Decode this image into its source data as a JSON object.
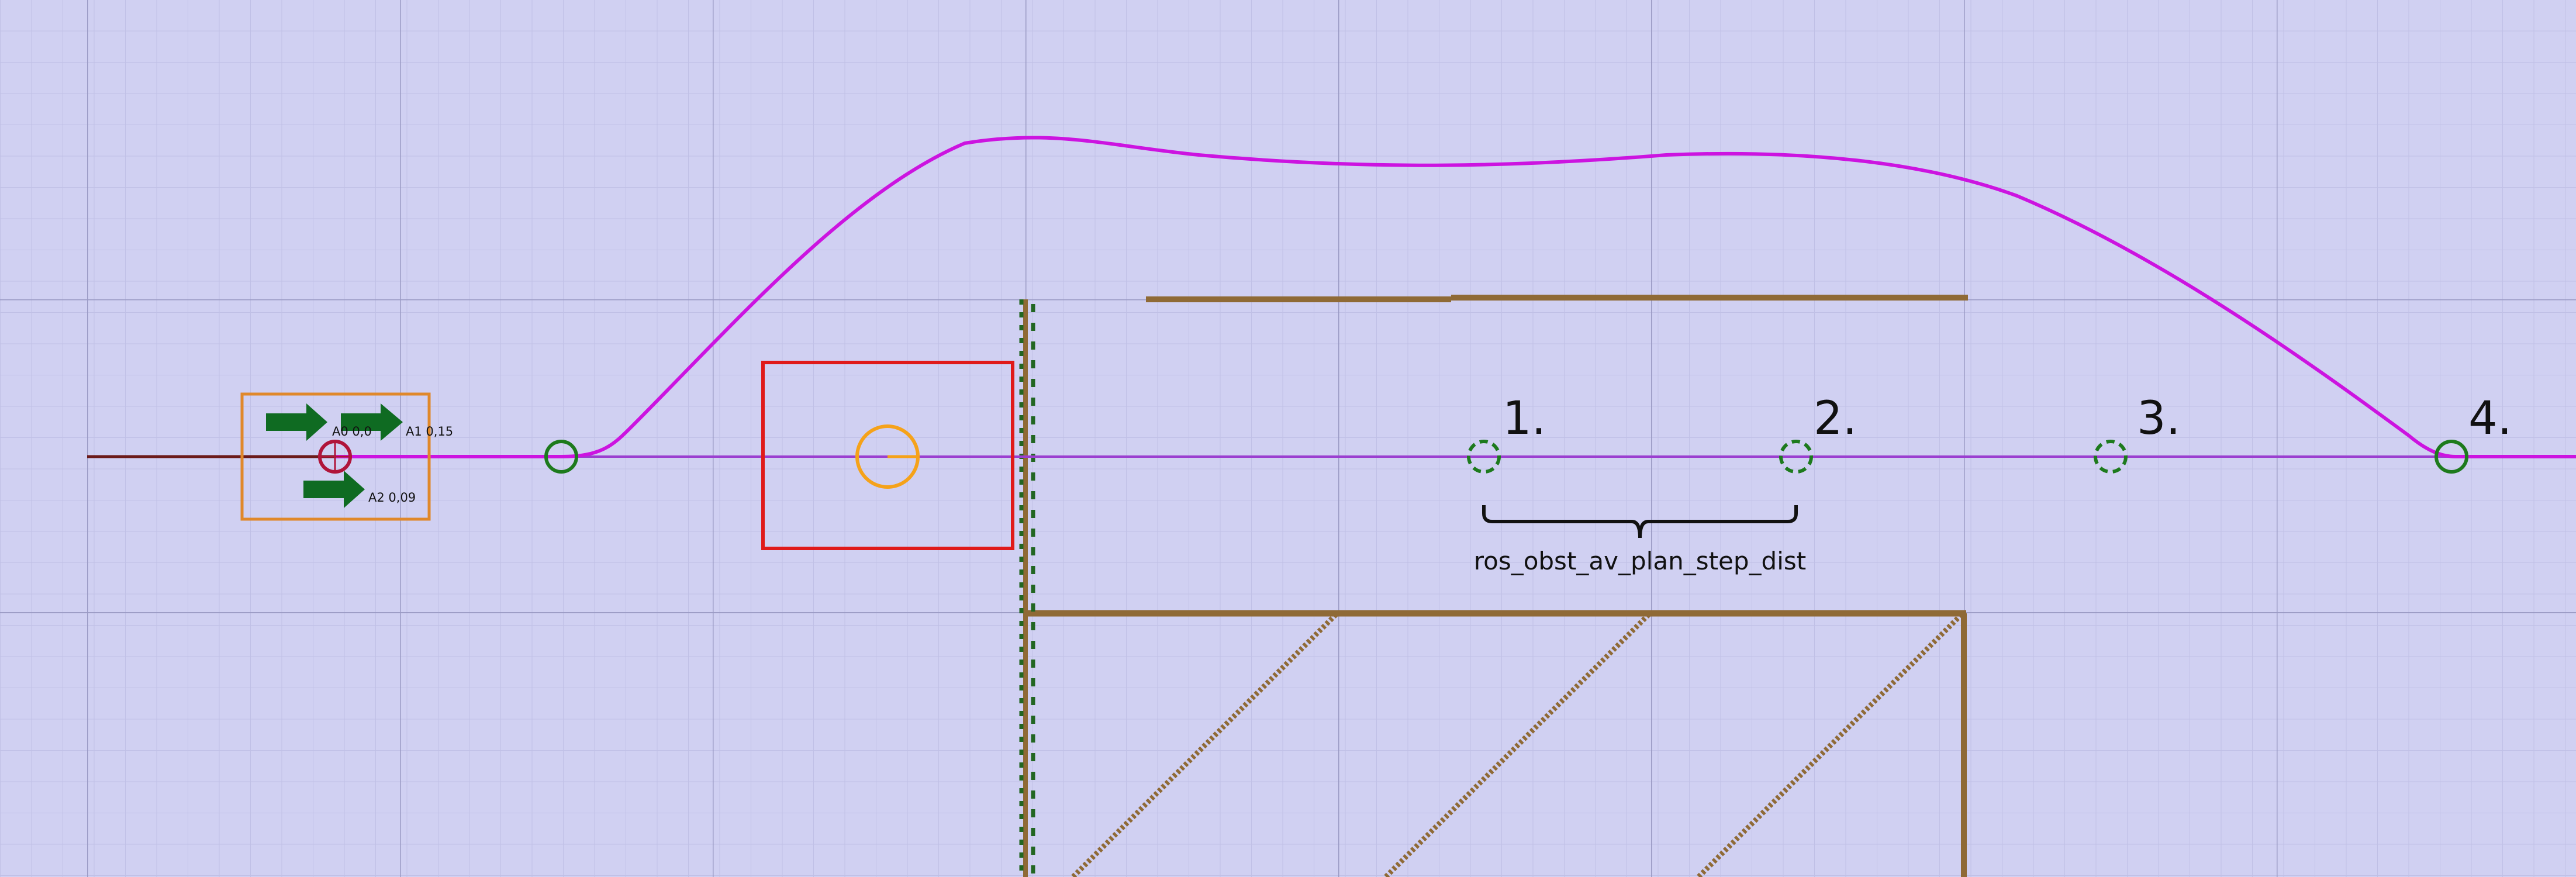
{
  "colors": {
    "background": "#d0d0f2",
    "grid_minor": "#c0c0e6",
    "grid_major": "#9a9ac4",
    "path": "#cc14e0",
    "planned_line": "#9b3fd0",
    "trail": "#6b1a1a",
    "waypoint": "#1d7a1d",
    "arrow": "#0f6b22",
    "obstacle": "#8f6a36",
    "detection_box": "#e01a1a",
    "robot": "#f5a21a",
    "footprint": "#e0882a",
    "pose_marker": "#b0143a",
    "occupancy": "#226622",
    "bracket": "#111111"
  },
  "robot": {
    "arrows": [
      {
        "label": "A0 0,0"
      },
      {
        "label": "A1 0,15"
      },
      {
        "label": "A2 0,09"
      }
    ]
  },
  "plan_steps": [
    {
      "label": "1."
    },
    {
      "label": "2."
    },
    {
      "label": "3."
    },
    {
      "label": "4."
    }
  ],
  "parameter_label": "ros_obst_av_plan_step_dist",
  "icons": {
    "waypoint": "circle-outline-icon",
    "plan_step": "dashed-circle-icon",
    "arrow": "right-arrow-icon",
    "pose": "crosshair-circle-icon"
  }
}
